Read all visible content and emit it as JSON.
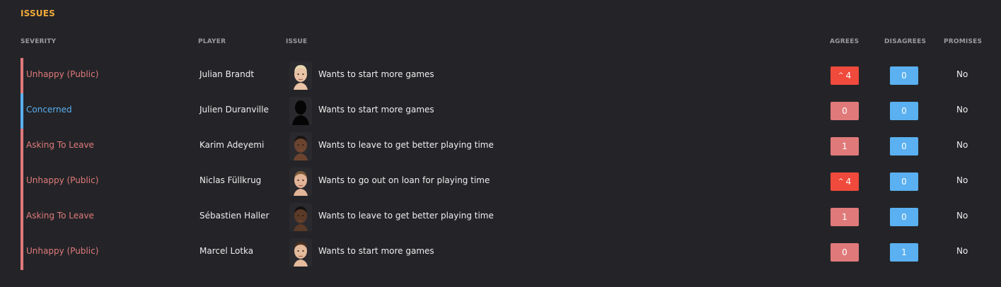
{
  "title": "ISSUES",
  "headers": {
    "severity": "SEVERITY",
    "player": "PLAYER",
    "issue": "ISSUE",
    "agrees": "AGREES",
    "disagrees": "DISAGREES",
    "promises": "PROMISES"
  },
  "colors": {
    "accent_title": "#f0a93a",
    "severity_red": "#e07a7a",
    "severity_blue": "#5ab0f0",
    "agree_high": "#f04a3c",
    "agree_normal": "#e07a7a",
    "disagree": "#5ab0f0"
  },
  "rows": [
    {
      "severity": "Unhappy (Public)",
      "severity_color": "#e07a7a",
      "player": "Julian Brandt",
      "face_icon": "player-face-icon",
      "issue": "Wants to start more games",
      "agrees": "4",
      "agrees_trend": "up",
      "agrees_color": "#f04a3c",
      "disagrees": "0",
      "promises": "No"
    },
    {
      "severity": "Concerned",
      "severity_color": "#5ab0f0",
      "player": "Julien Duranville",
      "face_icon": "player-silhouette-icon",
      "issue": "Wants to start more games",
      "agrees": "0",
      "agrees_trend": "",
      "agrees_color": "#e07a7a",
      "disagrees": "0",
      "promises": "No"
    },
    {
      "severity": "Asking To Leave",
      "severity_color": "#e07a7a",
      "player": "Karim Adeyemi",
      "face_icon": "player-face-icon",
      "issue": "Wants to leave to get better playing time",
      "agrees": "1",
      "agrees_trend": "",
      "agrees_color": "#e07a7a",
      "disagrees": "0",
      "promises": "No"
    },
    {
      "severity": "Unhappy (Public)",
      "severity_color": "#e07a7a",
      "player": "Niclas Füllkrug",
      "face_icon": "player-face-icon",
      "issue": "Wants to go out on loan for playing time",
      "agrees": "4",
      "agrees_trend": "up",
      "agrees_color": "#f04a3c",
      "disagrees": "0",
      "promises": "No"
    },
    {
      "severity": "Asking To Leave",
      "severity_color": "#e07a7a",
      "player": "Sébastien Haller",
      "face_icon": "player-face-icon",
      "issue": "Wants to leave to get better playing time",
      "agrees": "1",
      "agrees_trend": "",
      "agrees_color": "#e07a7a",
      "disagrees": "0",
      "promises": "No"
    },
    {
      "severity": "Unhappy (Public)",
      "severity_color": "#e07a7a",
      "player": "Marcel Lotka",
      "face_icon": "player-face-icon",
      "issue": "Wants to start more games",
      "agrees": "0",
      "agrees_trend": "",
      "agrees_color": "#e07a7a",
      "disagrees": "1",
      "promises": "No"
    }
  ]
}
